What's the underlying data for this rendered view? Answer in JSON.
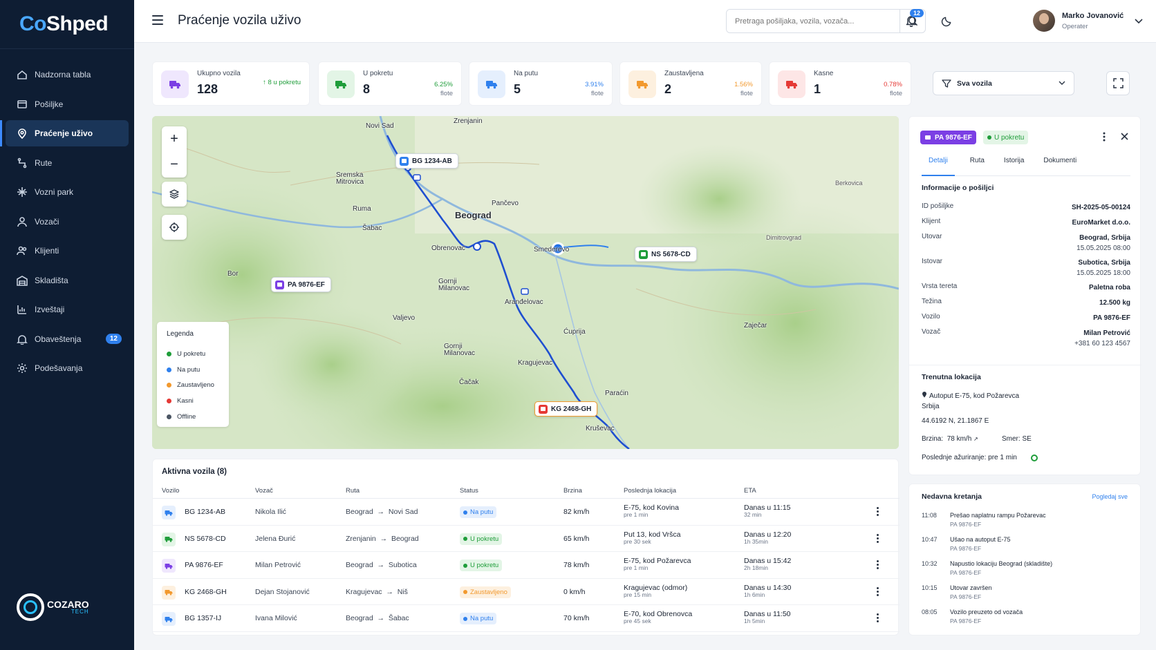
{
  "sidebar": {
    "logo_co": "Co",
    "logo_shped": "Shped",
    "items": [
      {
        "label": "Nadzorna tabla",
        "icon": "home-icon"
      },
      {
        "label": "Pošiljke",
        "icon": "package-icon"
      },
      {
        "label": "Praćenje uživo",
        "icon": "location-pin-icon",
        "active": true
      },
      {
        "label": "Rute",
        "icon": "route-icon"
      },
      {
        "label": "Vozni park",
        "icon": "fleet-icon"
      },
      {
        "label": "Vozači",
        "icon": "driver-icon"
      },
      {
        "label": "Klijenti",
        "icon": "clients-icon"
      },
      {
        "label": "Skladišta",
        "icon": "warehouse-icon"
      },
      {
        "label": "Izveštaji",
        "icon": "chart-icon"
      },
      {
        "label": "Obaveštenja",
        "icon": "bell-icon",
        "badge": "12"
      },
      {
        "label": "Podešavanja",
        "icon": "settings-icon"
      }
    ],
    "brand_name": "COZARO",
    "brand_sub": "TECH"
  },
  "header": {
    "title": "Praćenje vozila uživo",
    "search_placeholder": "Pretraga pošiljaka, vozila, vozača...",
    "notif_count": "12",
    "user_name": "Marko Jovanović",
    "user_role": "Operater"
  },
  "stats": [
    {
      "label": "Ukupno vozila",
      "value": "128",
      "extra": "↑ 8 u pokretu",
      "color": "#7b3fe4",
      "bg": "#efe7fd"
    },
    {
      "label": "U pokretu",
      "value": "8",
      "pct": "6.25%",
      "sub": "flote",
      "color": "#1f9d3a",
      "bg": "#e3f5e6"
    },
    {
      "label": "Na putu",
      "value": "5",
      "pct": "3.91%",
      "sub": "flote",
      "color": "#2f80ed",
      "bg": "#e5effd"
    },
    {
      "label": "Zaustavljena",
      "value": "2",
      "pct": "1.56%",
      "sub": "flote",
      "color": "#f2992e",
      "bg": "#fdf0df"
    },
    {
      "label": "Kasne",
      "value": "1",
      "pct": "0.78%",
      "sub": "flote",
      "color": "#e53935",
      "bg": "#fde6e6"
    }
  ],
  "filter": {
    "label": "Sva vozila"
  },
  "map": {
    "cities": [
      "Novi Sad",
      "Zrenjanin",
      "Sremska Mitrovica",
      "Pančevo",
      "Beograd",
      "Ruma",
      "Šabac",
      "Obrenovac",
      "Smederevo",
      "Bor",
      "Gornji Milanovac",
      "Aranđelovac",
      "Valjevo",
      "Ćuprija",
      "Zaječar",
      "Gornji Milanovac",
      "Kragujevac",
      "Čačak",
      "Paraćin",
      "Kruševac",
      "Dimitrovgrad",
      "Berkovica"
    ],
    "vehicles": {
      "bg1234": "BG 1234-AB",
      "ns5678": "NS 5678-CD",
      "pa9876": "PA 9876-EF",
      "kg2468": "KG 2468-GH"
    },
    "legend": {
      "title": "Legenda",
      "items": [
        {
          "label": "U pokretu",
          "color": "#1f9d3a"
        },
        {
          "label": "Na putu",
          "color": "#2f80ed"
        },
        {
          "label": "Zaustavljeno",
          "color": "#f2992e"
        },
        {
          "label": "Kasni",
          "color": "#e53935"
        },
        {
          "label": "Offline",
          "color": "#4b5563"
        }
      ]
    }
  },
  "details": {
    "plate": "PA 9876-EF",
    "status": "U pokretu",
    "tabs": [
      "Detalji",
      "Ruta",
      "Istorija",
      "Dokumenti"
    ],
    "section_title": "Informacije o pošiljci",
    "fields": [
      {
        "k": "ID pošiljke",
        "v": "SH-2025-05-00124",
        "sub": ""
      },
      {
        "k": "Klijent",
        "v": "EuroMarket d.o.o.",
        "sub": ""
      },
      {
        "k": "Utovar",
        "v": "Beograd, Srbija",
        "sub": "15.05.2025 08:00"
      },
      {
        "k": "Istovar",
        "v": "Subotica, Srbija",
        "sub": "15.05.2025 18:00"
      },
      {
        "k": "Vrsta tereta",
        "v": "Paletna roba",
        "sub": ""
      },
      {
        "k": "Težina",
        "v": "12.500 kg",
        "sub": ""
      },
      {
        "k": "Vozilo",
        "v": "PA 9876-EF",
        "sub": ""
      },
      {
        "k": "Vozač",
        "v": "Milan Petrović",
        "sub": "+381 60 123 4567"
      }
    ],
    "loc_title": "Trenutna lokacija",
    "loc_line1": "Autoput E-75, kod Požarevca",
    "loc_line2": "Srbija",
    "coords": "44.6192 N, 21.1867 E",
    "speed_label": "Brzina:",
    "speed_value": "78 km/h",
    "dir_label": "Smer:",
    "dir_value": "SE",
    "updated": "Poslednje ažuriranje: pre 1 min"
  },
  "recent": {
    "title": "Nedavna kretanja",
    "link": "Pogledaj sve",
    "items": [
      {
        "time": "11:08",
        "text": "Prešao naplatnu rampu Požarevac",
        "sub": "PA 9876-EF"
      },
      {
        "time": "10:47",
        "text": "Ušao na autoput E-75",
        "sub": "PA 9876-EF"
      },
      {
        "time": "10:32",
        "text": "Napustio lokaciju Beograd (skladište)",
        "sub": "PA 9876-EF"
      },
      {
        "time": "10:15",
        "text": "Utovar završen",
        "sub": "PA 9876-EF"
      },
      {
        "time": "08:05",
        "text": "Vozilo preuzeto od vozača",
        "sub": "PA 9876-EF"
      }
    ]
  },
  "table": {
    "title": "Aktivna vozila (8)",
    "headers": [
      "Vozilo",
      "Vozač",
      "Ruta",
      "Status",
      "Brzina",
      "Poslednja lokacija",
      "ETA"
    ],
    "rows": [
      {
        "vehicle": "BG 1234-AB",
        "driver": "Nikola Ilić",
        "from": "Beograd",
        "to": "Novi Sad",
        "status": "Na putu",
        "speed": "82 km/h",
        "loc": "E-75, kod Kovina",
        "loc_sub": "pre 1 min",
        "eta": "Danas u 11:15",
        "eta_sub": "32 min",
        "color": "#2f80ed",
        "bg": "#e5effd"
      },
      {
        "vehicle": "NS 5678-CD",
        "driver": "Jelena Đurić",
        "from": "Zrenjanin",
        "to": "Beograd",
        "status": "U pokretu",
        "speed": "65 km/h",
        "loc": "Put 13, kod Vršca",
        "loc_sub": "pre 30 sek",
        "eta": "Danas u 12:20",
        "eta_sub": "1h 35min",
        "color": "#1f9d3a",
        "bg": "#e3f5e6"
      },
      {
        "vehicle": "PA 9876-EF",
        "driver": "Milan Petrović",
        "from": "Beograd",
        "to": "Subotica",
        "status": "U pokretu",
        "speed": "78 km/h",
        "loc": "E-75, kod Požarevca",
        "loc_sub": "pre 1 min",
        "eta": "Danas u 15:42",
        "eta_sub": "2h 18min",
        "color": "#7b3fe4",
        "bg": "#efe7fd",
        "status_color": "#1f9d3a",
        "status_bg": "#e3f5e6"
      },
      {
        "vehicle": "KG 2468-GH",
        "driver": "Dejan Stojanović",
        "from": "Kragujevac",
        "to": "Niš",
        "status": "Zaustavljeno",
        "speed": "0 km/h",
        "loc": "Kragujevac (odmor)",
        "loc_sub": "pre 15 min",
        "eta": "Danas u 14:30",
        "eta_sub": "1h 6min",
        "color": "#f2992e",
        "bg": "#fdf0df"
      },
      {
        "vehicle": "BG 1357-IJ",
        "driver": "Ivana Milović",
        "from": "Beograd",
        "to": "Šabac",
        "status": "Na putu",
        "speed": "70 km/h",
        "loc": "E-70, kod Obrenovca",
        "loc_sub": "pre 45 sek",
        "eta": "Danas u 11:50",
        "eta_sub": "1h 5min",
        "color": "#2f80ed",
        "bg": "#e5effd"
      }
    ]
  }
}
